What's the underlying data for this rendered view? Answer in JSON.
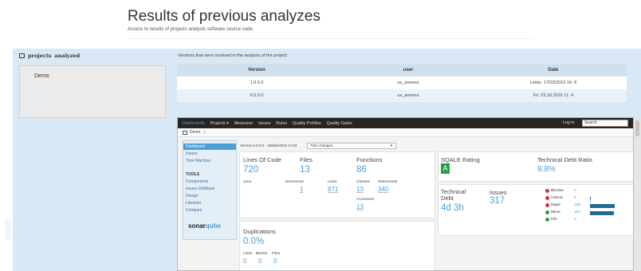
{
  "page": {
    "title": "Results of previous analyzes",
    "subtitle": "Access to results of projects analysis software source code."
  },
  "left": {
    "header_projects": "projects",
    "header_analyzed": "analyzed",
    "project_name": "Demo"
  },
  "versions": {
    "caption": "Versions that were involved in the analysis of the project:",
    "headers": [
      "Version",
      "user",
      "Date"
    ],
    "rows": [
      [
        "1.0.0.0",
        "us_amores",
        "Letter. 17/03/2016 16: 8"
      ],
      [
        "6.0.0.0",
        "us_amores",
        "Fri. 03.18.2016 11: 4"
      ]
    ]
  },
  "sonar": {
    "nav": [
      "Dashboards",
      "Projects ▾",
      "Measures",
      "Issues",
      "Rules",
      "Quality Profiles",
      "Quality Gates"
    ],
    "login": "Log in",
    "search_value": "Search",
    "crumb": "Demo",
    "side": {
      "items_top": [
        "Dashboard",
        "Issues",
        "Time Machine"
      ],
      "tools_heading": "TOOLS",
      "items_tools": [
        "Components",
        "Issues Drilldown",
        "Design",
        "Libraries",
        "Compare"
      ],
      "logo_part1": "sonar",
      "logo_part2": "qube"
    },
    "version_line": "Version 6.0.0.0 - 18/Mar/2016 11:04",
    "time_changes": "Time changes...",
    "size": {
      "loc_label": "Lines Of Code",
      "loc_value": "720",
      "language": "Java",
      "files_label": "Files",
      "files_value": "13",
      "directories_label": "Directories",
      "directories_value": "1",
      "lines_label": "Lines",
      "lines_value": "871",
      "functions_label": "Functions",
      "functions_value": "86",
      "classes_label": "Classes",
      "classes_value": "13",
      "statements_label": "Statements",
      "statements_value": "340",
      "accessors_label": "Accessors",
      "accessors_value": "13"
    },
    "duplications": {
      "title": "Duplications",
      "value": "0.0%",
      "labels": [
        "Lines",
        "Blocks",
        "Files"
      ],
      "values": [
        "0",
        "0",
        "0"
      ]
    },
    "sqale": {
      "label": "SQALE Rating",
      "rating": "A"
    },
    "debt_ratio": {
      "label": "Technical Debt Ratio",
      "value": "9.8%"
    },
    "debt": {
      "label": "Technical Debt",
      "value": "4d 3h"
    },
    "issues": {
      "label": "Issues",
      "value": "317",
      "severities": [
        {
          "name": "Blocker",
          "count": "0",
          "color": "#d4333f",
          "share": 0
        },
        {
          "name": "Critical",
          "count": "6",
          "color": "#d4333f",
          "share": 0.04
        },
        {
          "name": "Major",
          "count": "159",
          "color": "#d4333f",
          "share": 1
        },
        {
          "name": "Minor",
          "count": "152",
          "color": "#27a042",
          "share": 0.96
        },
        {
          "name": "Info",
          "count": "0",
          "color": "#27a042",
          "share": 0
        }
      ]
    }
  }
}
